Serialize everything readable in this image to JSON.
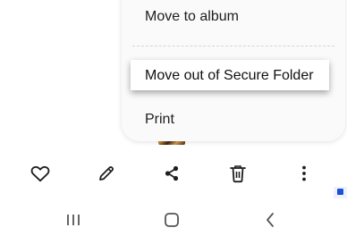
{
  "menu": {
    "items": [
      {
        "label": "Move to album"
      },
      {
        "label": "Move out of Secure Folder"
      },
      {
        "label": "Print"
      }
    ]
  },
  "toolbar": {
    "icons": [
      "heart-icon",
      "pencil-icon",
      "share-icon",
      "trash-icon",
      "more-vertical-icon"
    ]
  },
  "navigation": {
    "icons": [
      "recent-apps-icon",
      "home-icon",
      "back-icon"
    ]
  },
  "colors": {
    "icon": "#1e1e1e",
    "menu_background": "#fafafa",
    "highlight_background": "#ffffff",
    "badge": "#1f4fd6"
  }
}
